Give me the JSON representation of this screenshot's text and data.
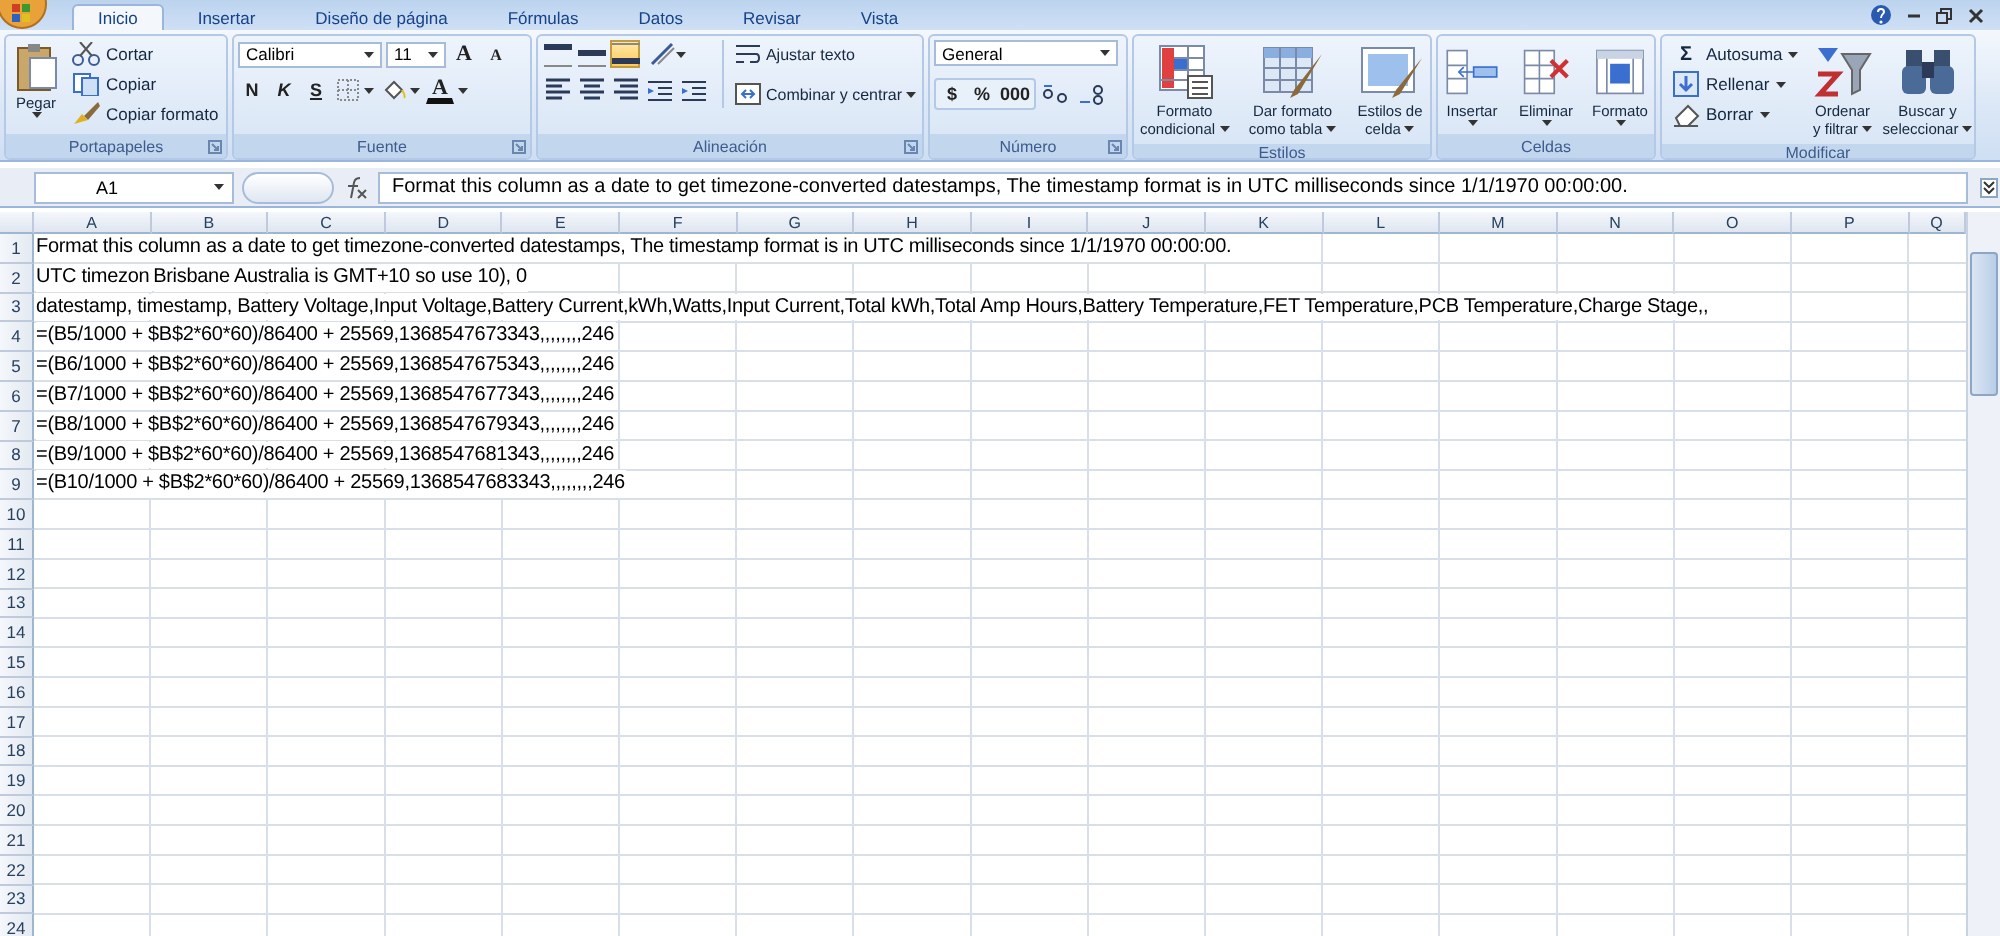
{
  "tabs": [
    {
      "label": "Inicio",
      "selected": true
    },
    {
      "label": "Insertar",
      "selected": false
    },
    {
      "label": "Diseño de página",
      "selected": false
    },
    {
      "label": "Fórmulas",
      "selected": false
    },
    {
      "label": "Datos",
      "selected": false
    },
    {
      "label": "Revisar",
      "selected": false
    },
    {
      "label": "Vista",
      "selected": false
    }
  ],
  "ribbon": {
    "groups": [
      {
        "kind": "clipboard",
        "title": "Portapapeles",
        "launcher": true,
        "paste": "Pegar",
        "items": [
          "Cortar",
          "Copiar",
          "Copiar formato"
        ]
      },
      {
        "kind": "font",
        "title": "Fuente",
        "launcher": true,
        "font": "Calibri",
        "size": "11",
        "grow": "A",
        "shrink": "A",
        "styles": [
          "N",
          "K",
          "S"
        ],
        "font_color": "A"
      },
      {
        "kind": "alignment",
        "title": "Alineación",
        "launcher": true,
        "vertical": [
          {
            "kind": "top",
            "selected": false
          },
          {
            "kind": "middle",
            "selected": false
          },
          {
            "kind": "bottom",
            "selected": true
          }
        ],
        "wrap": "Ajustar texto",
        "merge": "Combinar y centrar"
      },
      {
        "kind": "number",
        "title": "Número",
        "launcher": true,
        "format": "General",
        "symbols": [
          "$",
          "%",
          "000"
        ]
      },
      {
        "kind": "styles",
        "title": "Estilos",
        "launcher": false,
        "buttons": [
          {
            "kind": "conditional",
            "lines": [
              "Formato",
              "condicional"
            ]
          },
          {
            "kind": "table",
            "lines": [
              "Dar formato",
              "como tabla"
            ]
          },
          {
            "kind": "cellstyle",
            "lines": [
              "Estilos de",
              "celda"
            ]
          }
        ]
      },
      {
        "kind": "cells",
        "title": "Celdas",
        "launcher": false,
        "buttons": [
          {
            "kind": "insert",
            "lines": [
              "Insertar"
            ]
          },
          {
            "kind": "delete",
            "lines": [
              "Eliminar"
            ]
          },
          {
            "kind": "format",
            "lines": [
              "Formato"
            ]
          }
        ]
      },
      {
        "kind": "editing",
        "title": "Modificar",
        "launcher": false,
        "sum_symbol": "Σ",
        "items": [
          {
            "kind": "sum",
            "label": "Autosuma"
          },
          {
            "kind": "fill",
            "label": "Rellenar"
          },
          {
            "kind": "clear",
            "label": "Borrar"
          }
        ],
        "buttons": [
          {
            "kind": "sort",
            "lines": [
              "Ordenar",
              "y filtrar"
            ]
          },
          {
            "kind": "find",
            "lines": [
              "Buscar y",
              "seleccionar"
            ]
          }
        ]
      }
    ]
  },
  "formula_bar": {
    "name_box": "A1",
    "formula": "Format this column as a date to get timezone-converted datestamps, The timestamp format is in UTC milliseconds since 1/1/1970 00:00:00."
  },
  "sheet": {
    "columns": [
      "A",
      "B",
      "C",
      "D",
      "E",
      "F",
      "G",
      "H",
      "I",
      "J",
      "K",
      "L",
      "M",
      "N",
      "O",
      "P",
      "Q"
    ],
    "rows": [
      {
        "number": "1",
        "cells": [
          "Format this column as a date to get timezone-converted datestamps, The timestamp format is in UTC milliseconds since 1/1/1970 00:00:00."
        ]
      },
      {
        "number": "2",
        "cells": [
          "UTC timezon",
          "Brisbane Australia is GMT+10 so use 10), 0"
        ]
      },
      {
        "number": "3",
        "cells": [
          "datestamp, timestamp, Battery Voltage,Input Voltage,Battery Current,kWh,Watts,Input Current,Total kWh,Total Amp Hours,Battery Temperature,FET Temperature,PCB Temperature,Charge Stage,,"
        ]
      },
      {
        "number": "4",
        "cells": [
          "=(B5/1000 + $B$2*60*60)/86400 + 25569,1368547673343,,,,,,,,246"
        ]
      },
      {
        "number": "5",
        "cells": [
          "=(B6/1000 + $B$2*60*60)/86400 + 25569,1368547675343,,,,,,,,246"
        ]
      },
      {
        "number": "6",
        "cells": [
          "=(B7/1000 + $B$2*60*60)/86400 + 25569,1368547677343,,,,,,,,246"
        ]
      },
      {
        "number": "7",
        "cells": [
          "=(B8/1000 + $B$2*60*60)/86400 + 25569,1368547679343,,,,,,,,246"
        ]
      },
      {
        "number": "8",
        "cells": [
          "=(B9/1000 + $B$2*60*60)/86400 + 25569,1368547681343,,,,,,,,246"
        ]
      },
      {
        "number": "9",
        "cells": [
          "=(B10/1000 + $B$2*60*60)/86400 + 25569,1368547683343,,,,,,,,246"
        ]
      },
      {
        "number": "10"
      },
      {
        "number": "11"
      },
      {
        "number": "12"
      },
      {
        "number": "13"
      },
      {
        "number": "14"
      },
      {
        "number": "15"
      },
      {
        "number": "16"
      },
      {
        "number": "17"
      },
      {
        "number": "18"
      },
      {
        "number": "19"
      },
      {
        "number": "20"
      },
      {
        "number": "21"
      },
      {
        "number": "22"
      },
      {
        "number": "23"
      },
      {
        "number": "24"
      }
    ]
  }
}
